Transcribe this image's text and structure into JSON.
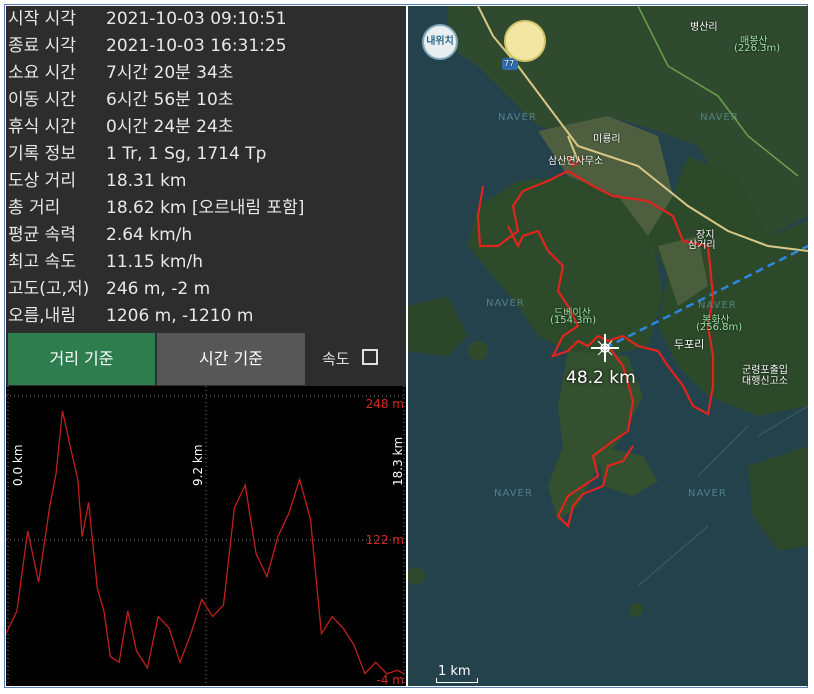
{
  "info": {
    "rows": [
      {
        "label": "시작 시각",
        "value": "2021-10-03 09:10:51"
      },
      {
        "label": "종료 시각",
        "value": "2021-10-03 16:31:25"
      },
      {
        "label": "소요 시간",
        "value": "7시간 20분 34초"
      },
      {
        "label": "이동 시간",
        "value": "6시간 56분 10초"
      },
      {
        "label": "휴식 시간",
        "value": "0시간 24분 24초"
      },
      {
        "label": "기록 정보",
        "value": "1 Tr, 1 Sg, 1714 Tp"
      },
      {
        "label": "도상 거리",
        "value": "18.31 km"
      },
      {
        "label": "총 거리",
        "value": "18.62 km [오르내림 포함]"
      },
      {
        "label": "평균 속력",
        "value": "2.64 km/h"
      },
      {
        "label": "최고 속도",
        "value": "11.15 km/h"
      },
      {
        "label": "고도(고,저)",
        "value": "246 m, -2 m"
      },
      {
        "label": "오름,내림",
        "value": "1206 m, -1210 m"
      }
    ]
  },
  "tabs": {
    "distance": "거리 기준",
    "time": "시간 기준",
    "speed": "속도"
  },
  "graph": {
    "max_label": "248 m",
    "mid_label": "122 m",
    "min_label": "-4 m",
    "x_labels": [
      "0.0 km",
      "9.2 km",
      "18.3 km"
    ],
    "colors": {
      "line": "#c0201c",
      "label": "#d42a1f",
      "grid": "#808080"
    }
  },
  "chart_data": {
    "type": "line",
    "xlabel": "",
    "ylabel": "",
    "xlim": [
      0,
      18.3
    ],
    "ylim": [
      -4,
      248
    ],
    "x": [
      0.0,
      0.5,
      1.0,
      1.5,
      2.0,
      2.3,
      2.6,
      3.0,
      3.3,
      3.5,
      3.8,
      4.2,
      4.5,
      4.8,
      5.2,
      5.6,
      6.0,
      6.5,
      7.0,
      7.5,
      8.0,
      8.5,
      9.0,
      9.5,
      10.0,
      10.5,
      11.0,
      11.5,
      12.0,
      12.5,
      13.0,
      13.5,
      14.0,
      14.5,
      15.0,
      15.5,
      16.0,
      16.5,
      17.0,
      17.5,
      18.0,
      18.3
    ],
    "y": [
      40,
      60,
      130,
      85,
      150,
      180,
      235,
      200,
      175,
      125,
      155,
      80,
      60,
      20,
      15,
      60,
      25,
      10,
      55,
      45,
      15,
      40,
      70,
      55,
      65,
      150,
      170,
      110,
      90,
      125,
      145,
      175,
      140,
      40,
      55,
      45,
      30,
      5,
      15,
      5,
      8,
      5
    ],
    "series": [
      {
        "values": [
          40,
          60,
          130,
          85,
          150,
          180,
          235,
          200,
          175,
          125,
          155,
          80,
          60,
          20,
          15,
          60,
          25,
          10,
          55,
          45,
          15,
          40,
          70,
          55,
          65,
          150,
          170,
          110,
          90,
          125,
          145,
          175,
          140,
          40,
          55,
          45,
          30,
          5,
          15,
          5,
          8,
          5
        ]
      }
    ]
  },
  "map": {
    "labels": {
      "mountain1": "병산리",
      "mountain2_name": "매봉산",
      "mountain2_height": "(226.3m)",
      "village1": "미룡리",
      "office": "삼산면사무소",
      "junction": "장지",
      "junction2": "삼거리",
      "peak1_name": "드베이산",
      "peak1_height": "(154.3m)",
      "peak2_name": "봉화산",
      "peak2_height": "(256.8m)",
      "village2": "두포리",
      "right1": "군령포출입",
      "right2": "대행신고소",
      "route": "77",
      "naver": "NAVER",
      "current_location": "내위치"
    },
    "distance_label": "48.2 km",
    "scale_label": "1 km",
    "colors": {
      "track": "#e0241e",
      "measure": "#2e86de"
    }
  }
}
